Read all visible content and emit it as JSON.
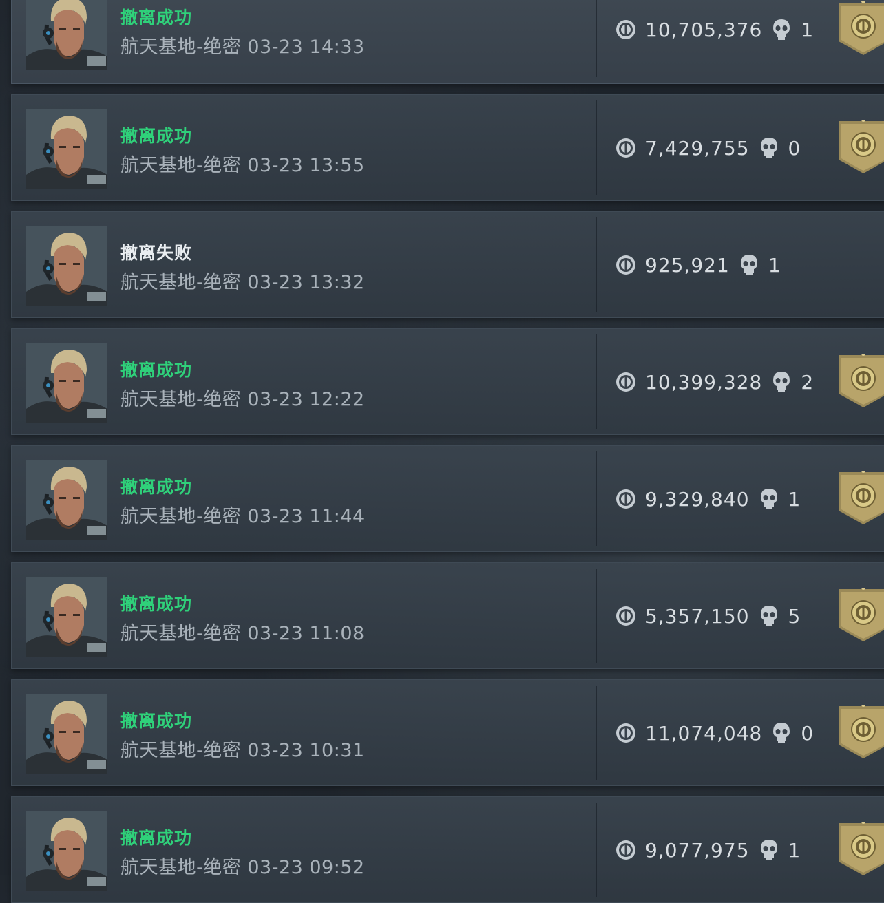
{
  "records": [
    {
      "status": "撤离成功",
      "success": true,
      "map": "航天基地-绝密",
      "datetime": "03-23 14:33",
      "value": "10,705,376",
      "kills": "1",
      "badge": true
    },
    {
      "status": "撤离成功",
      "success": true,
      "map": "航天基地-绝密",
      "datetime": "03-23 13:55",
      "value": "7,429,755",
      "kills": "0",
      "badge": true
    },
    {
      "status": "撤离失败",
      "success": false,
      "map": "航天基地-绝密",
      "datetime": "03-23 13:32",
      "value": "925,921",
      "kills": "1",
      "badge": false
    },
    {
      "status": "撤离成功",
      "success": true,
      "map": "航天基地-绝密",
      "datetime": "03-23 12:22",
      "value": "10,399,328",
      "kills": "2",
      "badge": true
    },
    {
      "status": "撤离成功",
      "success": true,
      "map": "航天基地-绝密",
      "datetime": "03-23 11:44",
      "value": "9,329,840",
      "kills": "1",
      "badge": true
    },
    {
      "status": "撤离成功",
      "success": true,
      "map": "航天基地-绝密",
      "datetime": "03-23 11:08",
      "value": "5,357,150",
      "kills": "5",
      "badge": true
    },
    {
      "status": "撤离成功",
      "success": true,
      "map": "航天基地-绝密",
      "datetime": "03-23 10:31",
      "value": "11,074,048",
      "kills": "0",
      "badge": true
    },
    {
      "status": "撤离成功",
      "success": true,
      "map": "航天基地-绝密",
      "datetime": "03-23 09:52",
      "value": "9,077,975",
      "kills": "1",
      "badge": true
    }
  ],
  "icons": {
    "avatar": "operator-portrait",
    "value": "coin-icon",
    "kills": "skull-icon",
    "badge": "gold-shield-badge"
  },
  "colors": {
    "success": "#2fd17a",
    "fail": "#e9edf0",
    "badge_gold": "#b8a46a"
  }
}
